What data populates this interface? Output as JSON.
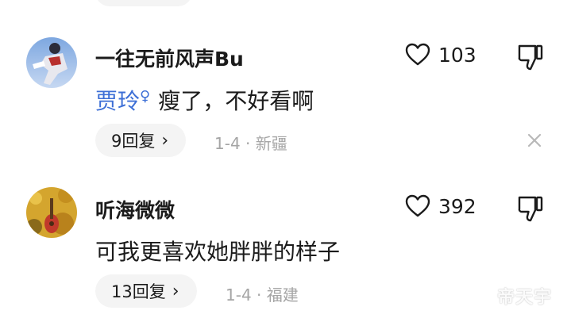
{
  "comments": [
    {
      "username": "一往无前风声Bu",
      "like_count": "103",
      "mention": "贾玲",
      "text": "瘦了，不好看啊",
      "reply_label": "9回复",
      "meta": "1-4 · 新疆"
    },
    {
      "username": "听海微微",
      "like_count": "392",
      "text": "可我更喜欢她胖胖的样子",
      "reply_label": "13回复",
      "meta": "1-4 · 福建"
    }
  ],
  "watermark": "帝天宇",
  "icons": {
    "like": "heart-outline-icon",
    "dislike": "thumbs-down-icon",
    "reply": "chevron-right-icon",
    "close": "close-icon",
    "mention": "person-icon"
  },
  "colors": {
    "mention": "#3d6fd6",
    "meta": "#a5a5a5",
    "pill": "#f4f4f4"
  }
}
